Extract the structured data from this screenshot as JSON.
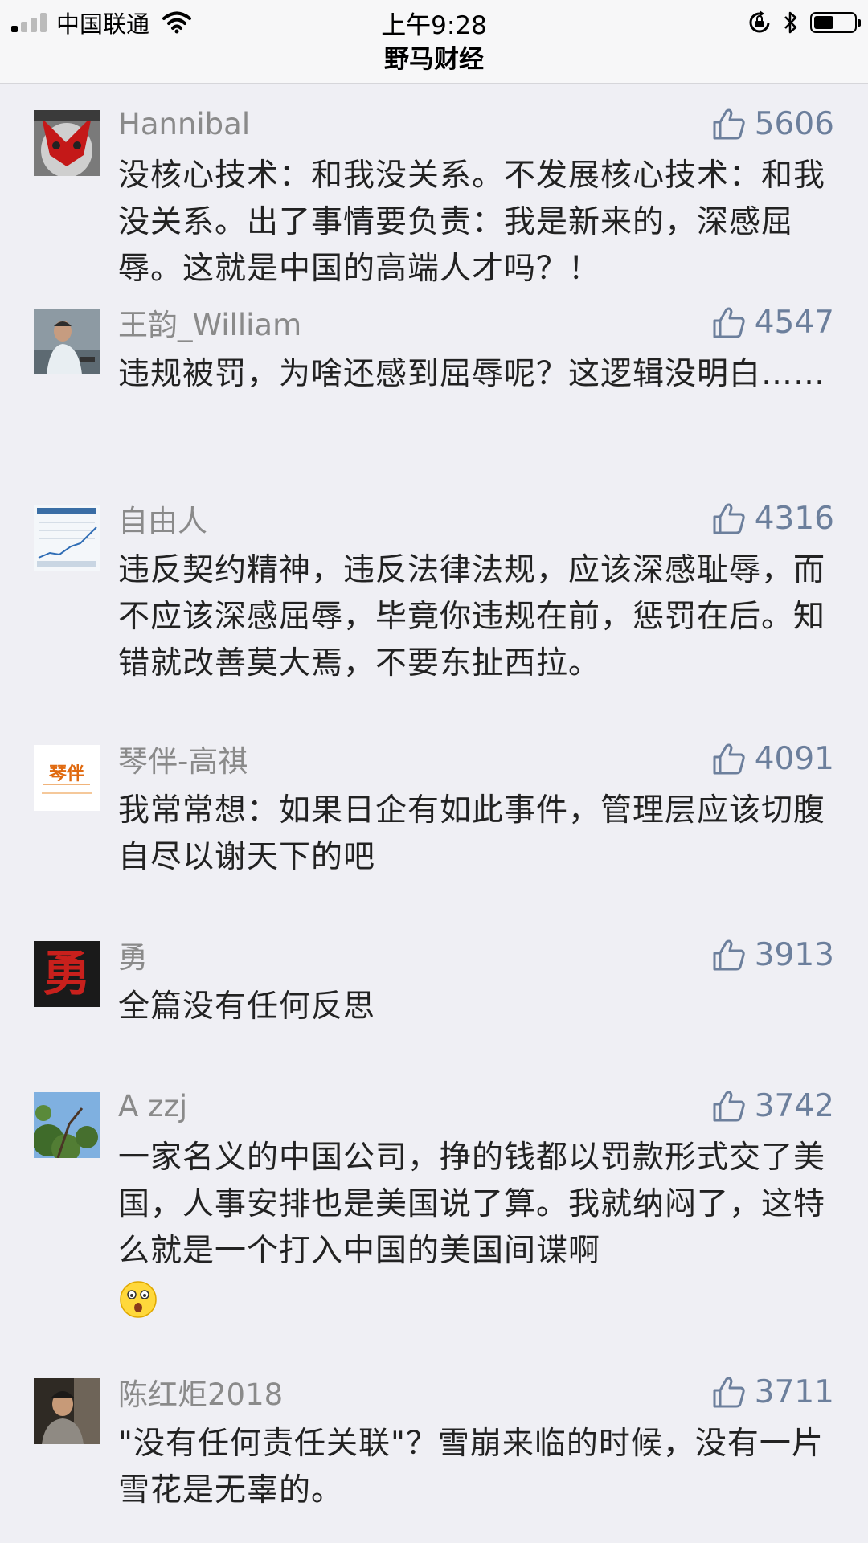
{
  "status_bar": {
    "carrier": "中国联通",
    "time": "上午9:28",
    "title": "野马财经"
  },
  "colors": {
    "accent": "#6c7f9c",
    "username": "#8a8a8a",
    "text": "#222222",
    "background": "#efeff4"
  },
  "comments": [
    {
      "user": "Hannibal",
      "likes": "5606",
      "text": "没核心技术：和我没关系。不发展核心技术：和我没关系。出了事情要负责：我是新来的，深感屈辱。这就是中国的高端人才吗？！",
      "avatar": "red-face-avatar"
    },
    {
      "user": "王韵_William",
      "likes": "4547",
      "text": "违规被罚，为啥还感到屈辱呢？这逻辑没明白……",
      "avatar": "man-photo-avatar"
    },
    {
      "user": "自由人",
      "likes": "4316",
      "text": "违反契约精神，违反法律法规，应该深感耻辱，而不应该深感屈辱，毕竟你违规在前，惩罚在后。知错就改善莫大焉，不要东扯西拉。",
      "avatar": "chart-avatar"
    },
    {
      "user": "琴伴-高祺",
      "likes": "4091",
      "text": "我常常想：如果日企有如此事件，管理层应该切腹自尽以谢天下的吧",
      "avatar": "qinban-logo-avatar",
      "avatar_text": "琴伴"
    },
    {
      "user": "勇",
      "likes": "3913",
      "text": "全篇没有任何反思",
      "avatar": "yong-calligraphy-avatar",
      "avatar_text": "勇"
    },
    {
      "user": "A zzj",
      "likes": "3742",
      "text": "一家名义的中国公司，挣的钱都以罚款形式交了美国，人事安排也是美国说了算。我就纳闷了，这特么就是一个打入中国的美国间谍啊",
      "avatar": "tree-sky-avatar",
      "has_emoji": "surprised-face-emoji"
    },
    {
      "user": "陈红炬2018",
      "likes": "3711",
      "text": "\"没有任何责任关联\"？雪崩来临的时候，没有一片雪花是无辜的。",
      "avatar": "man-dark-photo-avatar"
    }
  ]
}
